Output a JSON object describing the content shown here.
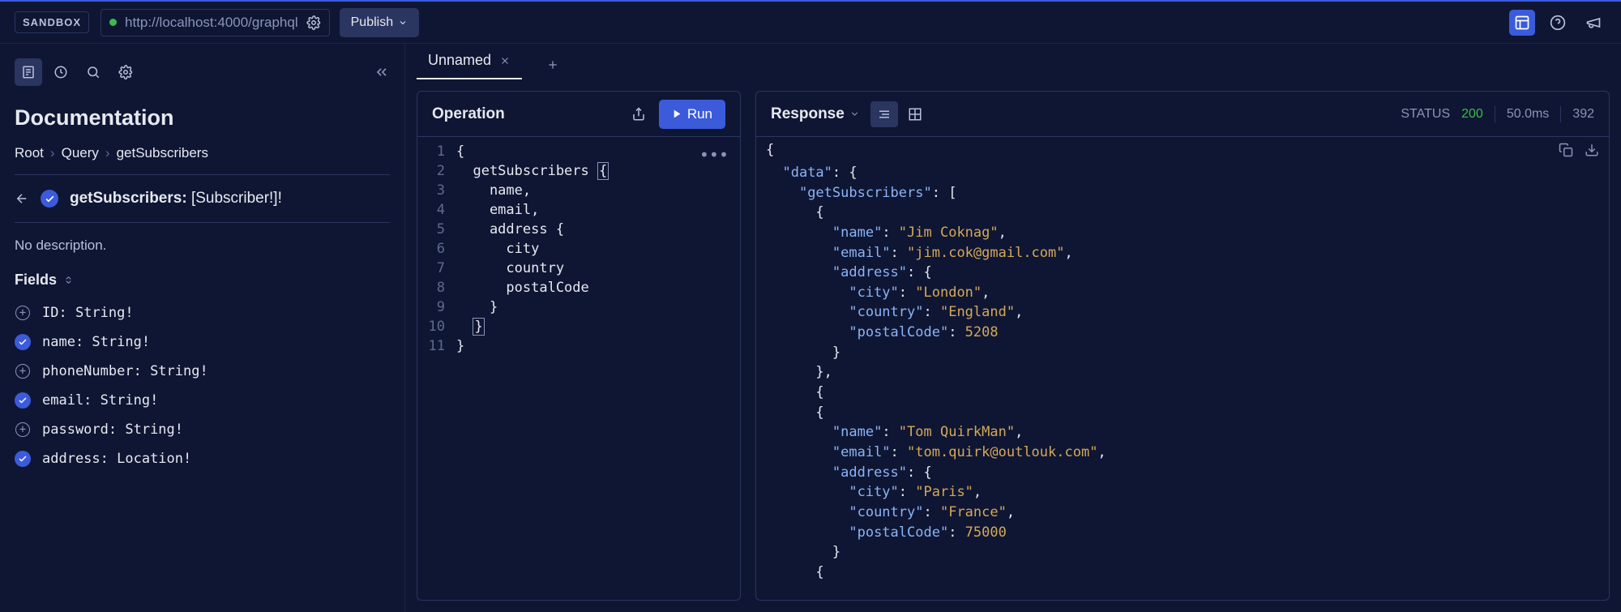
{
  "topbar": {
    "sandbox_label": "SANDBOX",
    "url": "http://localhost:4000/graphql",
    "publish_label": "Publish"
  },
  "sidebar": {
    "title": "Documentation",
    "breadcrumbs": [
      "Root",
      "Query",
      "getSubscribers"
    ],
    "operation_name": "getSubscribers:",
    "return_type": "[Subscriber!]!",
    "no_description": "No description.",
    "fields_label": "Fields",
    "fields": [
      {
        "name": "ID:",
        "type": "String!",
        "selected": false
      },
      {
        "name": "name:",
        "type": "String!",
        "selected": true
      },
      {
        "name": "phoneNumber:",
        "type": "String!",
        "selected": false
      },
      {
        "name": "email:",
        "type": "String!",
        "selected": true
      },
      {
        "name": "password:",
        "type": "String!",
        "selected": false
      },
      {
        "name": "address:",
        "type": "Location!",
        "selected": true
      }
    ]
  },
  "tabs": {
    "active_label": "Unnamed"
  },
  "operation": {
    "title": "Operation",
    "run_label": "Run",
    "lines": [
      "{",
      "  getSubscribers {",
      "    name,",
      "    email,",
      "    address {",
      "      city",
      "      country",
      "      postalCode",
      "    }",
      "  }",
      "}"
    ]
  },
  "response": {
    "title": "Response",
    "status_label": "STATUS",
    "status_code": "200",
    "time": "50.0ms",
    "size": "392",
    "json": {
      "data": {
        "getSubscribers": [
          {
            "name": "Jim Coknag",
            "email": "jim.cok@gmail.com",
            "address": {
              "city": "London",
              "country": "England",
              "postalCode": 5208
            }
          },
          {
            "name": "Tom QuirkMan",
            "email": "tom.quirk@outlouk.com",
            "address": {
              "city": "Paris",
              "country": "France",
              "postalCode": 75000
            }
          }
        ]
      }
    }
  }
}
